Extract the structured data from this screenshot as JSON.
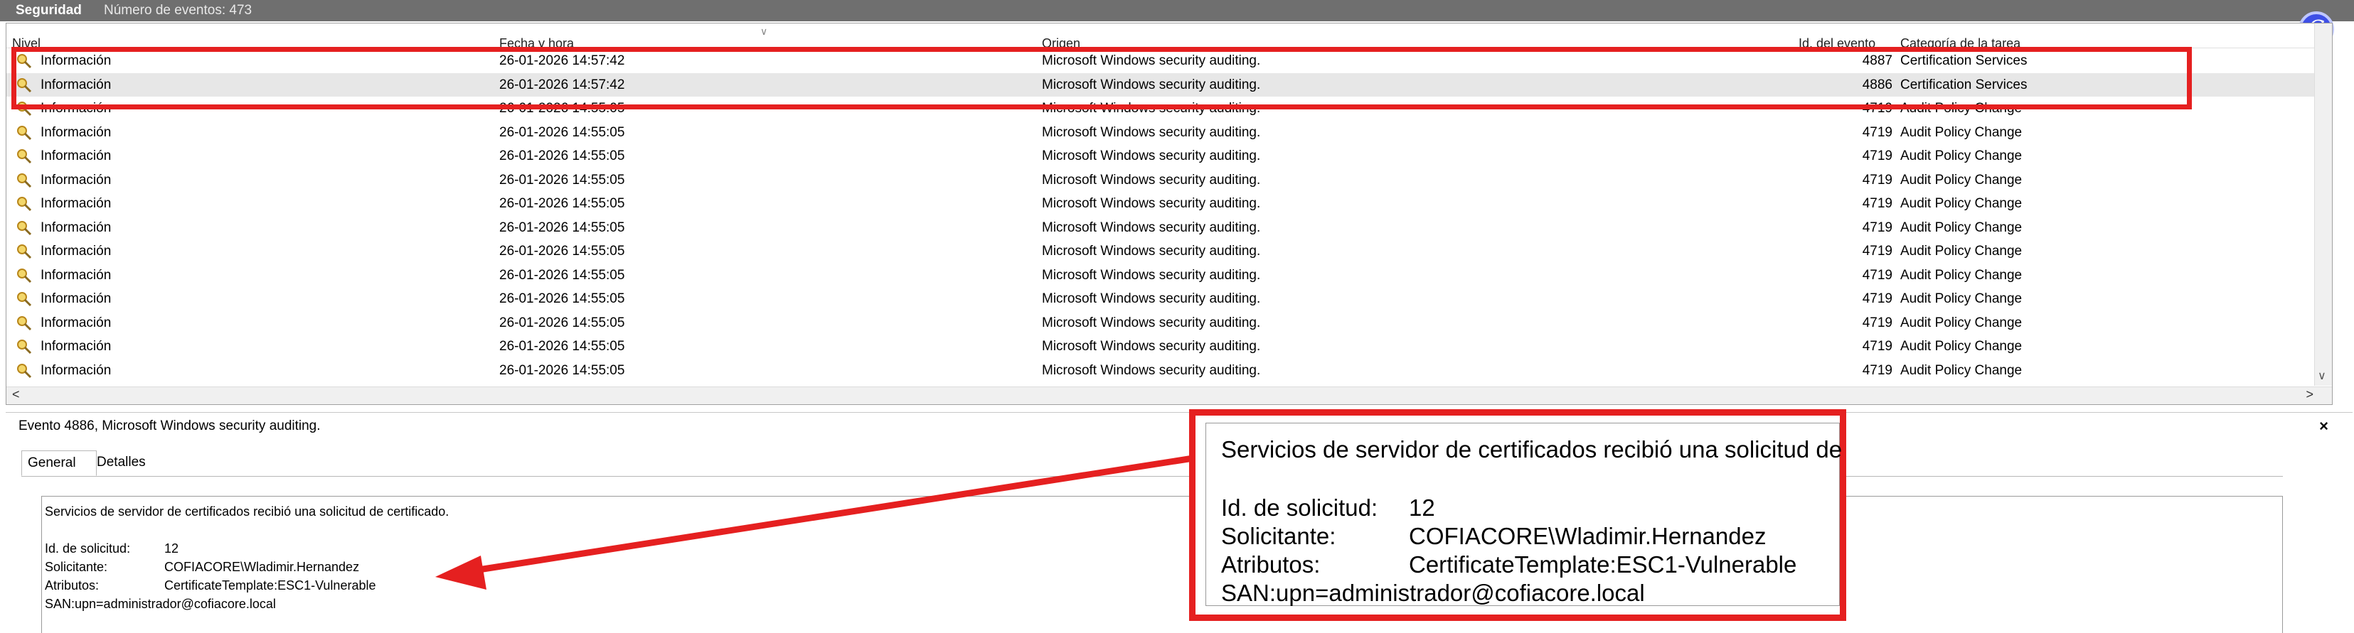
{
  "title_bar": {
    "log_name": "Seguridad",
    "event_count": "Número de eventos: 473"
  },
  "columns": [
    "Nivel",
    "Fecha y hora",
    "Origen",
    "Id. del evento",
    "Categoría de la tarea"
  ],
  "events": [
    {
      "level": "Información",
      "date": "26-01-2026 14:57:42",
      "source": "Microsoft Windows security auditing.",
      "id": "4887",
      "category": "Certification Services"
    },
    {
      "level": "Información",
      "date": "26-01-2026 14:57:42",
      "source": "Microsoft Windows security auditing.",
      "id": "4886",
      "category": "Certification Services"
    },
    {
      "level": "Información",
      "date": "26-01-2026 14:55:05",
      "source": "Microsoft Windows security auditing.",
      "id": "4719",
      "category": "Audit Policy Change"
    },
    {
      "level": "Información",
      "date": "26-01-2026 14:55:05",
      "source": "Microsoft Windows security auditing.",
      "id": "4719",
      "category": "Audit Policy Change"
    },
    {
      "level": "Información",
      "date": "26-01-2026 14:55:05",
      "source": "Microsoft Windows security auditing.",
      "id": "4719",
      "category": "Audit Policy Change"
    },
    {
      "level": "Información",
      "date": "26-01-2026 14:55:05",
      "source": "Microsoft Windows security auditing.",
      "id": "4719",
      "category": "Audit Policy Change"
    },
    {
      "level": "Información",
      "date": "26-01-2026 14:55:05",
      "source": "Microsoft Windows security auditing.",
      "id": "4719",
      "category": "Audit Policy Change"
    },
    {
      "level": "Información",
      "date": "26-01-2026 14:55:05",
      "source": "Microsoft Windows security auditing.",
      "id": "4719",
      "category": "Audit Policy Change"
    },
    {
      "level": "Información",
      "date": "26-01-2026 14:55:05",
      "source": "Microsoft Windows security auditing.",
      "id": "4719",
      "category": "Audit Policy Change"
    },
    {
      "level": "Información",
      "date": "26-01-2026 14:55:05",
      "source": "Microsoft Windows security auditing.",
      "id": "4719",
      "category": "Audit Policy Change"
    },
    {
      "level": "Información",
      "date": "26-01-2026 14:55:05",
      "source": "Microsoft Windows security auditing.",
      "id": "4719",
      "category": "Audit Policy Change"
    },
    {
      "level": "Información",
      "date": "26-01-2026 14:55:05",
      "source": "Microsoft Windows security auditing.",
      "id": "4719",
      "category": "Audit Policy Change"
    },
    {
      "level": "Información",
      "date": "26-01-2026 14:55:05",
      "source": "Microsoft Windows security auditing.",
      "id": "4719",
      "category": "Audit Policy Change"
    },
    {
      "level": "Información",
      "date": "26-01-2026 14:55:05",
      "source": "Microsoft Windows security auditing.",
      "id": "4719",
      "category": "Audit Policy Change"
    }
  ],
  "selected_index": 1,
  "detail": {
    "header": "Evento 4886, Microsoft Windows security auditing.",
    "close": "×",
    "tabs": [
      "General",
      "Detalles"
    ],
    "message": "Servicios de servidor de certificados recibió una solicitud de certificado.",
    "fields": [
      {
        "label": "Id. de solicitud:",
        "value": "12"
      },
      {
        "label": "Solicitante:",
        "value": "COFIACORE\\Wladimir.Hernandez"
      },
      {
        "label": "Atributos:",
        "value": "CertificateTemplate:ESC1-Vulnerable"
      }
    ],
    "san": "SAN:upn=administrador@cofiacore.local"
  },
  "zoom": {
    "message": "Servicios de servidor de certificados recibió una solicitud de",
    "fields": [
      {
        "label": "Id. de solicitud:",
        "value": "12"
      },
      {
        "label": "Solicitante:",
        "value": "COFIACORE\\Wladimir.Hernandez"
      },
      {
        "label": "Atributos:",
        "value": "CertificateTemplate:ESC1-Vulnerable"
      }
    ],
    "san": "SAN:upn=administrador@cofiacore.local"
  },
  "colors": {
    "annotation": "#e52020",
    "title_bar": "#6f6f6f",
    "selected_row": "#e7e7e7",
    "badge": "#3e4fe6"
  },
  "icons": {
    "event_level": "key-magnifier-icon",
    "assistant": "assistant-badge-icon"
  },
  "assistant_badge_glyph": "C"
}
